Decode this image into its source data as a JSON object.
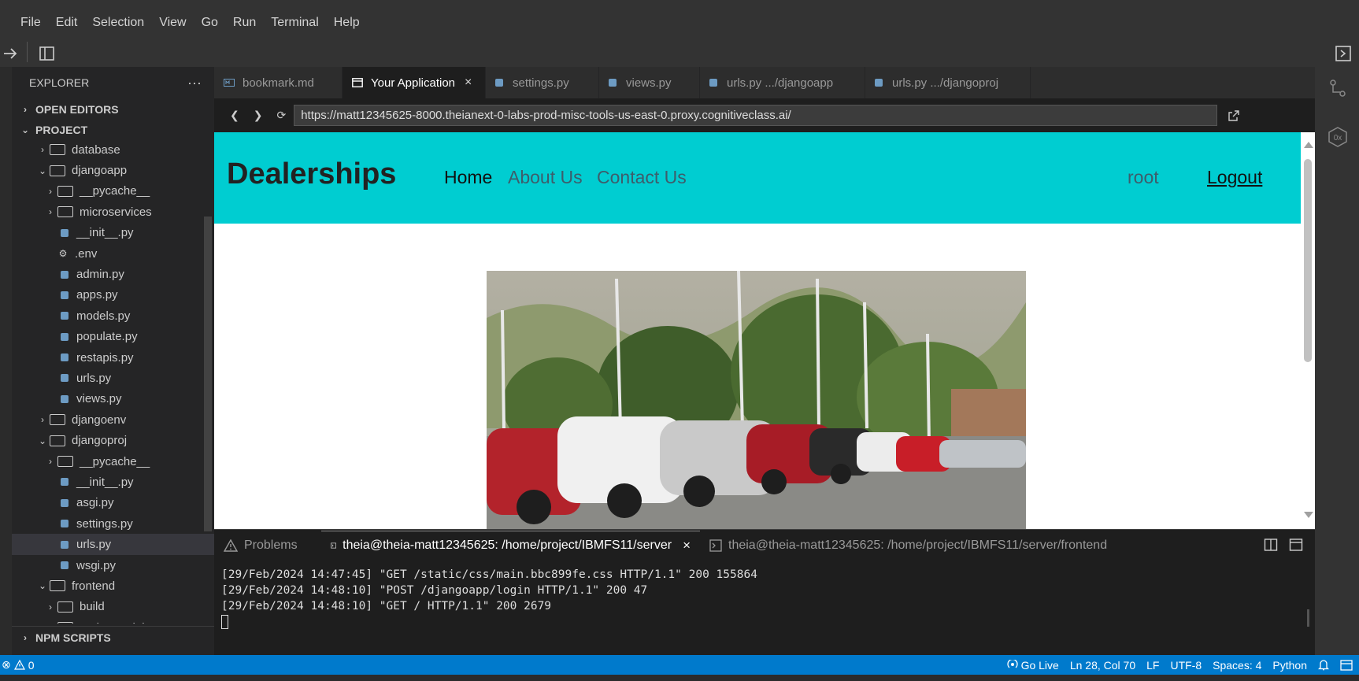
{
  "menu": [
    "File",
    "Edit",
    "Selection",
    "View",
    "Go",
    "Run",
    "Terminal",
    "Help"
  ],
  "explorer": {
    "title": "EXPLORER",
    "more": "···",
    "open_editors": "OPEN EDITORS",
    "project": "PROJECT",
    "npm_scripts": "NPM SCRIPTS",
    "tree": [
      {
        "label": "database",
        "type": "folder",
        "level": 1,
        "expanded": false
      },
      {
        "label": "djangoapp",
        "type": "folder",
        "level": 1,
        "expanded": true
      },
      {
        "label": "__pycache__",
        "type": "folder",
        "level": 2,
        "expanded": false
      },
      {
        "label": "microservices",
        "type": "folder",
        "level": 2,
        "expanded": false
      },
      {
        "label": "__init__.py",
        "type": "py",
        "level": 2
      },
      {
        "label": ".env",
        "type": "gear",
        "level": 2
      },
      {
        "label": "admin.py",
        "type": "py",
        "level": 2
      },
      {
        "label": "apps.py",
        "type": "py",
        "level": 2
      },
      {
        "label": "models.py",
        "type": "py",
        "level": 2
      },
      {
        "label": "populate.py",
        "type": "py",
        "level": 2
      },
      {
        "label": "restapis.py",
        "type": "py",
        "level": 2
      },
      {
        "label": "urls.py",
        "type": "py",
        "level": 2
      },
      {
        "label": "views.py",
        "type": "py",
        "level": 2
      },
      {
        "label": "djangoenv",
        "type": "folder",
        "level": 1,
        "expanded": false
      },
      {
        "label": "djangoproj",
        "type": "folder",
        "level": 1,
        "expanded": true
      },
      {
        "label": "__pycache__",
        "type": "folder",
        "level": 2,
        "expanded": false
      },
      {
        "label": "__init__.py",
        "type": "py",
        "level": 2
      },
      {
        "label": "asgi.py",
        "type": "py",
        "level": 2
      },
      {
        "label": "settings.py",
        "type": "py",
        "level": 2
      },
      {
        "label": "urls.py",
        "type": "py",
        "level": 2,
        "selected": true
      },
      {
        "label": "wsgi.py",
        "type": "py",
        "level": 2
      },
      {
        "label": "frontend",
        "type": "folder",
        "level": 1,
        "expanded": true
      },
      {
        "label": "build",
        "type": "folder",
        "level": 2,
        "expanded": false
      },
      {
        "label": "node_modules",
        "type": "folder",
        "level": 2,
        "expanded": false
      }
    ]
  },
  "tabs": [
    {
      "label": "bookmark.md",
      "active": false,
      "icon": "markdown-icon"
    },
    {
      "label": "Your Application",
      "active": true,
      "icon": "browser-icon"
    },
    {
      "label": "settings.py",
      "active": false,
      "icon": "python-icon"
    },
    {
      "label": "views.py",
      "active": false,
      "icon": "python-icon"
    },
    {
      "label": "urls.py .../djangoapp",
      "active": false,
      "icon": "python-icon"
    },
    {
      "label": "urls.py .../djangoproj",
      "active": false,
      "icon": "python-icon"
    }
  ],
  "browser": {
    "url": "https://matt12345625-8000.theianext-0-labs-prod-misc-tools-us-east-0.proxy.cognitiveclass.ai/"
  },
  "web": {
    "brand": "Dealerships",
    "nav_home": "Home",
    "nav_about": "About Us",
    "nav_contact": "Contact Us",
    "user": "root",
    "logout": "Logout",
    "nav_color": "#00cdd1"
  },
  "panel": {
    "problems": "Problems",
    "term1": "theia@theia-matt12345625: /home/project/IBMFS11/server",
    "term2": "theia@theia-matt12345625: /home/project/IBMFS11/server/frontend"
  },
  "terminal_lines": [
    "[29/Feb/2024 14:47:45] \"GET /static/css/main.bbc899fe.css HTTP/1.1\" 200 155864",
    "[29/Feb/2024 14:48:10] \"POST /djangoapp/login HTTP/1.1\" 200 47",
    "[29/Feb/2024 14:48:10] \"GET / HTTP/1.1\" 200 2679"
  ],
  "status": {
    "problems": "0",
    "warnings_count": "0",
    "go_live": "Go Live",
    "position": "Ln 28, Col 70",
    "eol": "LF",
    "encoding": "UTF-8",
    "spaces": "Spaces: 4",
    "language": "Python",
    "accent": "#007acc"
  }
}
